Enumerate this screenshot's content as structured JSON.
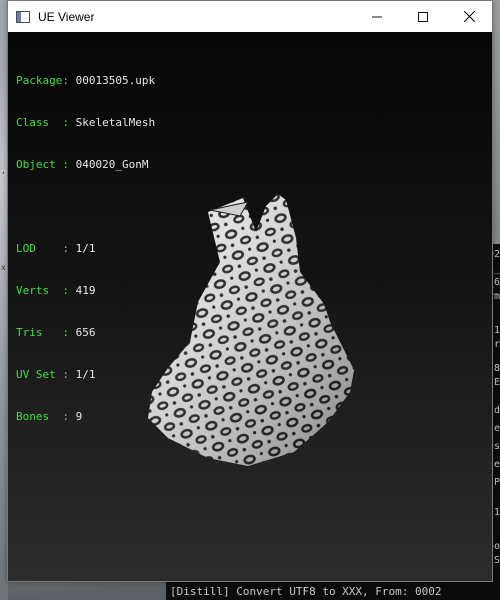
{
  "window": {
    "title": "UE Viewer"
  },
  "info": {
    "header": [
      {
        "key": "Package: ",
        "value": "00013505.upk"
      },
      {
        "key": "Class  : ",
        "value": "SkeletalMesh"
      },
      {
        "key": "Object : ",
        "value": "040020_GonM"
      }
    ],
    "stats": [
      {
        "key": "LOD    : ",
        "value": "1/1"
      },
      {
        "key": "Verts  : ",
        "value": "419"
      },
      {
        "key": "Tris   : ",
        "value": "656"
      },
      {
        "key": "UV Set : ",
        "value": "1/1"
      },
      {
        "key": "Bones  : ",
        "value": "9"
      }
    ]
  },
  "console": {
    "fragments": [
      "02",
      "1_",
      "_6",
      "rm",
      "1",
      "r",
      "8",
      "E",
      "d",
      "e",
      "es",
      "e",
      "P",
      "1",
      "oo",
      "CS"
    ],
    "bottom_line": "[Distill] Convert UTF8 to XXX, From: 0002"
  },
  "colors": {
    "label": "#3fe03f",
    "value": "#e8e8e8",
    "viewport_top": "#060606",
    "viewport_bottom": "#2c2c2c"
  }
}
